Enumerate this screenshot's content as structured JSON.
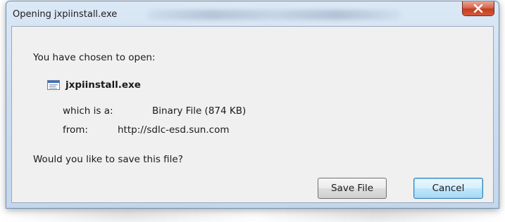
{
  "window": {
    "title": "Opening jxpiinstall.exe"
  },
  "dialog": {
    "prompt": "You have chosen to open:",
    "file_name": "jxpiinstall.exe",
    "file_icon": "executable-file-icon",
    "which_is_label": "which is a:",
    "which_is_value": "Binary File (874 KB)",
    "from_label": "from:",
    "from_value": "http://sdlc-esd.sun.com",
    "question": "Would you like to save this file?"
  },
  "buttons": {
    "save_label": "Save File",
    "cancel_label": "Cancel",
    "close_icon": "close-icon"
  },
  "colors": {
    "close_button": "#c33e1f",
    "default_button_border": "#3c7fb1",
    "frame": "#cfdeef"
  }
}
